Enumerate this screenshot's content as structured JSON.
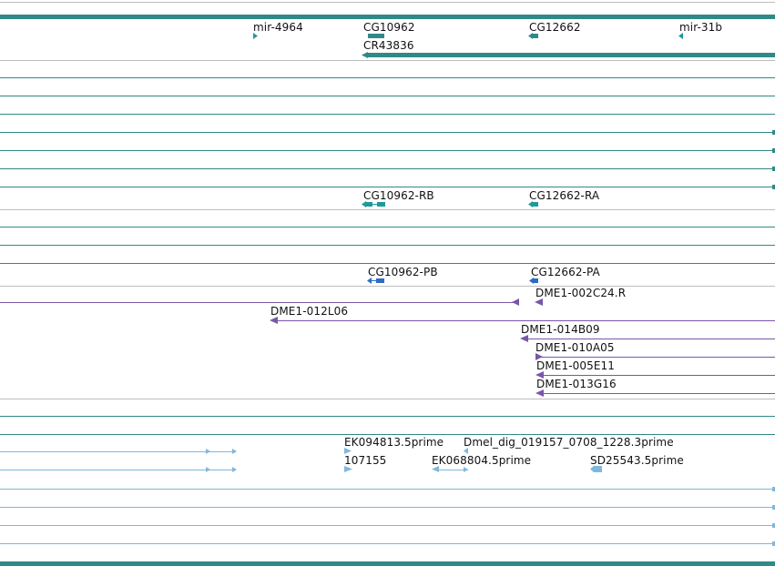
{
  "colors": {
    "teal": "#2f8a87",
    "teal_light": "#1f9a9a",
    "blue": "#2c6cc4",
    "purple": "#7a56a8",
    "sky": "#7fb8dd",
    "track_divider": "#bdbdbd"
  },
  "gene_track": {
    "labels": [
      "mir-4964",
      "CG10962",
      "CR43836",
      "CG12662",
      "mir-31b"
    ]
  },
  "transcript_track": {
    "labels": [
      "CG10962-RB",
      "CG12662-RA"
    ]
  },
  "protein_track": {
    "labels": [
      "CG10962-PB",
      "CG12662-PA"
    ]
  },
  "clone_track": {
    "labels": [
      "DME1-002C24.R",
      "DME1-012L06",
      "DME1-014B09",
      "DME1-010A05",
      "DME1-005E11",
      "DME1-013G16"
    ]
  },
  "est_track": {
    "labels": [
      "EK094813.5prime",
      "Dmel_dig_019157_0708_1228.3prime",
      "107155",
      "EK068804.5prime",
      "SD25543.5prime"
    ]
  }
}
